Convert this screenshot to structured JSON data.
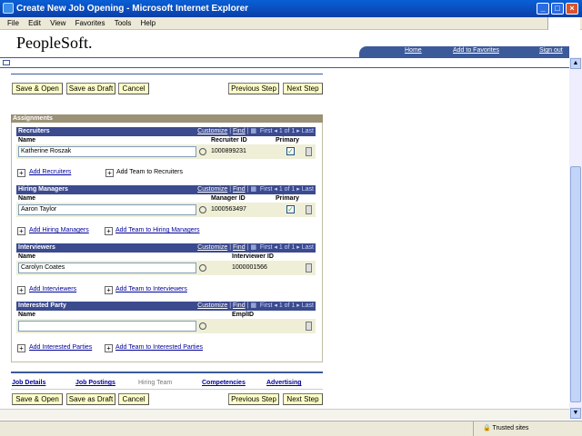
{
  "window": {
    "title": "Create New Job Opening - Microsoft Internet Explorer"
  },
  "menu": [
    "File",
    "Edit",
    "View",
    "Favorites",
    "Tools",
    "Help"
  ],
  "brand": "PeopleSoft.",
  "header_links": {
    "home": "Home",
    "add_favorites": "Add to Favorites",
    "sign_out": "Sign out"
  },
  "buttons": {
    "save_open": "Save & Open",
    "save_draft": "Save as Draft",
    "cancel": "Cancel",
    "prev": "Previous Step",
    "next": "Next Step"
  },
  "assignments_title": "Assignments",
  "grid_nav": {
    "customize": "Customize",
    "find": "Find",
    "first": "First",
    "count": "1 of 1",
    "last": "Last"
  },
  "recruiters": {
    "title": "Recruiters",
    "col_name": "Name",
    "col_id": "Recruiter ID",
    "col_primary": "Primary",
    "name": "Katherine Roszak",
    "id": "1000899231",
    "add": "Add Recruiters",
    "add_team": "Add Team to Recruiters"
  },
  "hiring": {
    "title": "Hiring Managers",
    "col_name": "Name",
    "col_id": "Manager ID",
    "col_primary": "Primary",
    "name": "Aaron Taylor",
    "id": "1000563497",
    "add": "Add Hiring Managers",
    "add_team": "Add Team to Hiring Managers"
  },
  "interviewers": {
    "title": "Interviewers",
    "col_name": "Name",
    "col_id": "Interviewer ID",
    "name": "Carolyn Coates",
    "id": "1000001566",
    "add": "Add Interviewers",
    "add_team": "Add Team to Interviewers"
  },
  "interested": {
    "title": "Interested Party",
    "col_name": "Name",
    "col_id": "EmplID",
    "name": "",
    "add": "Add Interested Parties",
    "add_team": "Add Team to Interested Parties"
  },
  "tabs": {
    "job_details": "Job Details",
    "job_postings": "Job Postings",
    "hiring_team": "Hiring Team",
    "competencies": "Competencies",
    "advertising": "Advertising"
  },
  "status": {
    "zone": "Trusted sites"
  }
}
